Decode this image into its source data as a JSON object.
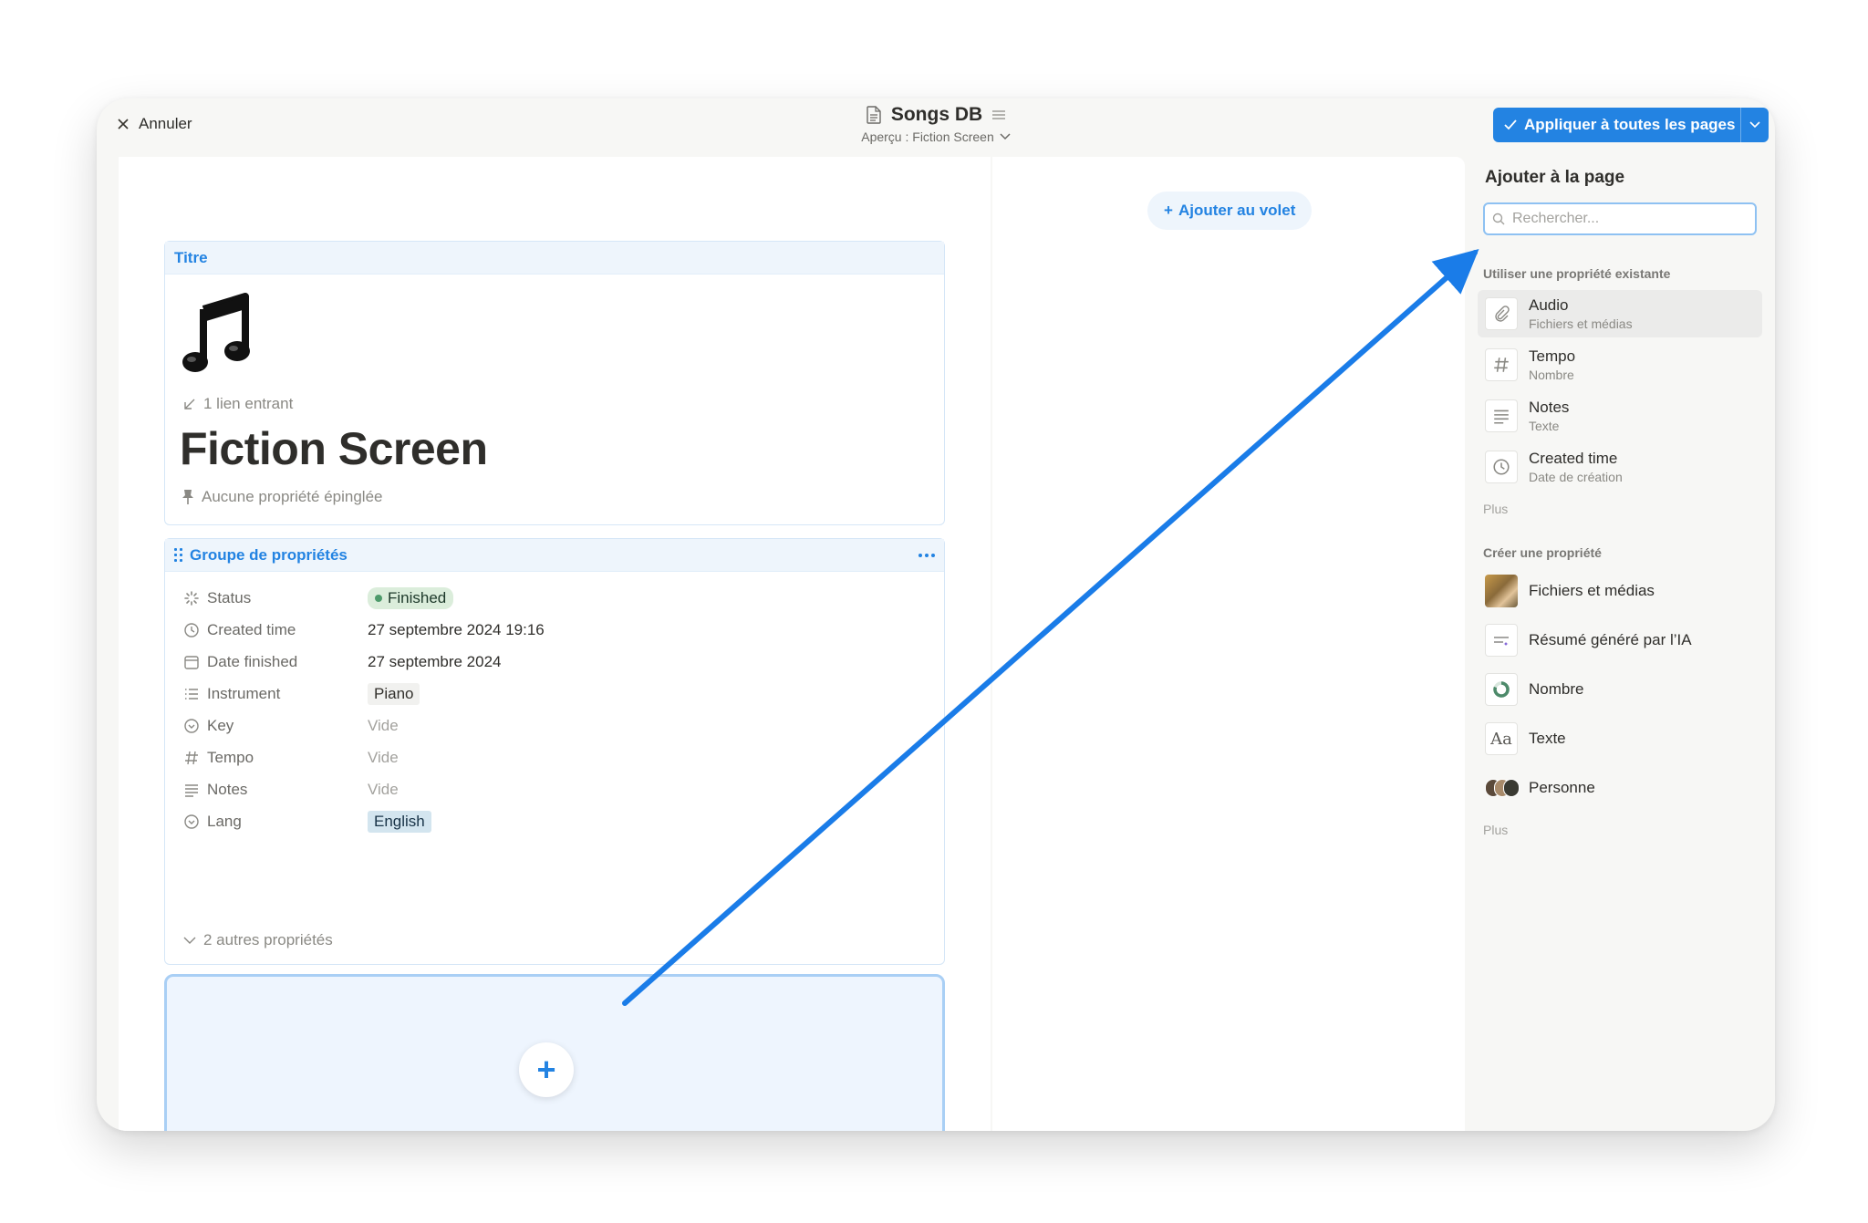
{
  "header": {
    "cancel_label": "Annuler",
    "db_title": "Songs DB",
    "preview_label": "Aperçu : Fiction Screen",
    "apply_label": "Appliquer à toutes les pages"
  },
  "page": {
    "title_section_label": "Titre",
    "icon_name": "musical-note-icon",
    "backlinks": "1 lien entrant",
    "title": "Fiction Screen",
    "pinned": "Aucune propriété épinglée"
  },
  "property_group": {
    "label": "Groupe de propriétés",
    "properties": [
      {
        "name": "Status",
        "icon": "status-icon",
        "value": "Finished",
        "kind": "status"
      },
      {
        "name": "Created time",
        "icon": "clock-icon",
        "value": "27 septembre 2024 19:16",
        "kind": "text"
      },
      {
        "name": "Date finished",
        "icon": "calendar-icon",
        "value": "27 septembre 2024",
        "kind": "text"
      },
      {
        "name": "Instrument",
        "icon": "list-icon",
        "value": "Piano",
        "kind": "tag-gray"
      },
      {
        "name": "Key",
        "icon": "select-icon",
        "value": "Vide",
        "kind": "empty"
      },
      {
        "name": "Tempo",
        "icon": "hash-icon",
        "value": "Vide",
        "kind": "empty"
      },
      {
        "name": "Notes",
        "icon": "text-icon",
        "value": "Vide",
        "kind": "empty"
      },
      {
        "name": "Lang",
        "icon": "select-icon",
        "value": "English",
        "kind": "tag-blue"
      }
    ],
    "more_label": "2 autres propriétés"
  },
  "middle": {
    "add_to_panel_label": "Ajouter au volet"
  },
  "sidebar": {
    "title": "Ajouter à la page",
    "search_placeholder": "Rechercher...",
    "existing_label": "Utiliser une propriété existante",
    "existing": [
      {
        "name": "Audio",
        "type": "Fichiers et médias",
        "icon": "paperclip-icon"
      },
      {
        "name": "Tempo",
        "type": "Nombre",
        "icon": "hash-icon"
      },
      {
        "name": "Notes",
        "type": "Texte",
        "icon": "text-icon"
      },
      {
        "name": "Created time",
        "type": "Date de création",
        "icon": "clock-icon"
      }
    ],
    "existing_more": "Plus",
    "create_label": "Créer une propriété",
    "create": [
      {
        "name": "Fichiers et médias",
        "icon": "painting-thumbnail-icon"
      },
      {
        "name": "Résumé généré par l’IA",
        "icon": "ai-summary-icon"
      },
      {
        "name": "Nombre",
        "icon": "number-ring-icon"
      },
      {
        "name": "Texte",
        "icon": "text-aa-icon"
      },
      {
        "name": "Personne",
        "icon": "people-avatars-icon"
      }
    ],
    "create_more": "Plus"
  },
  "colors": {
    "accent": "#2383e2",
    "status_green_bg": "#dbeddb",
    "status_dot": "#4d9a6a",
    "tag_blue_bg": "#d3e5ef",
    "tag_gray_bg": "#f1f1ef",
    "annotation_arrow": "#1a7ce8"
  }
}
